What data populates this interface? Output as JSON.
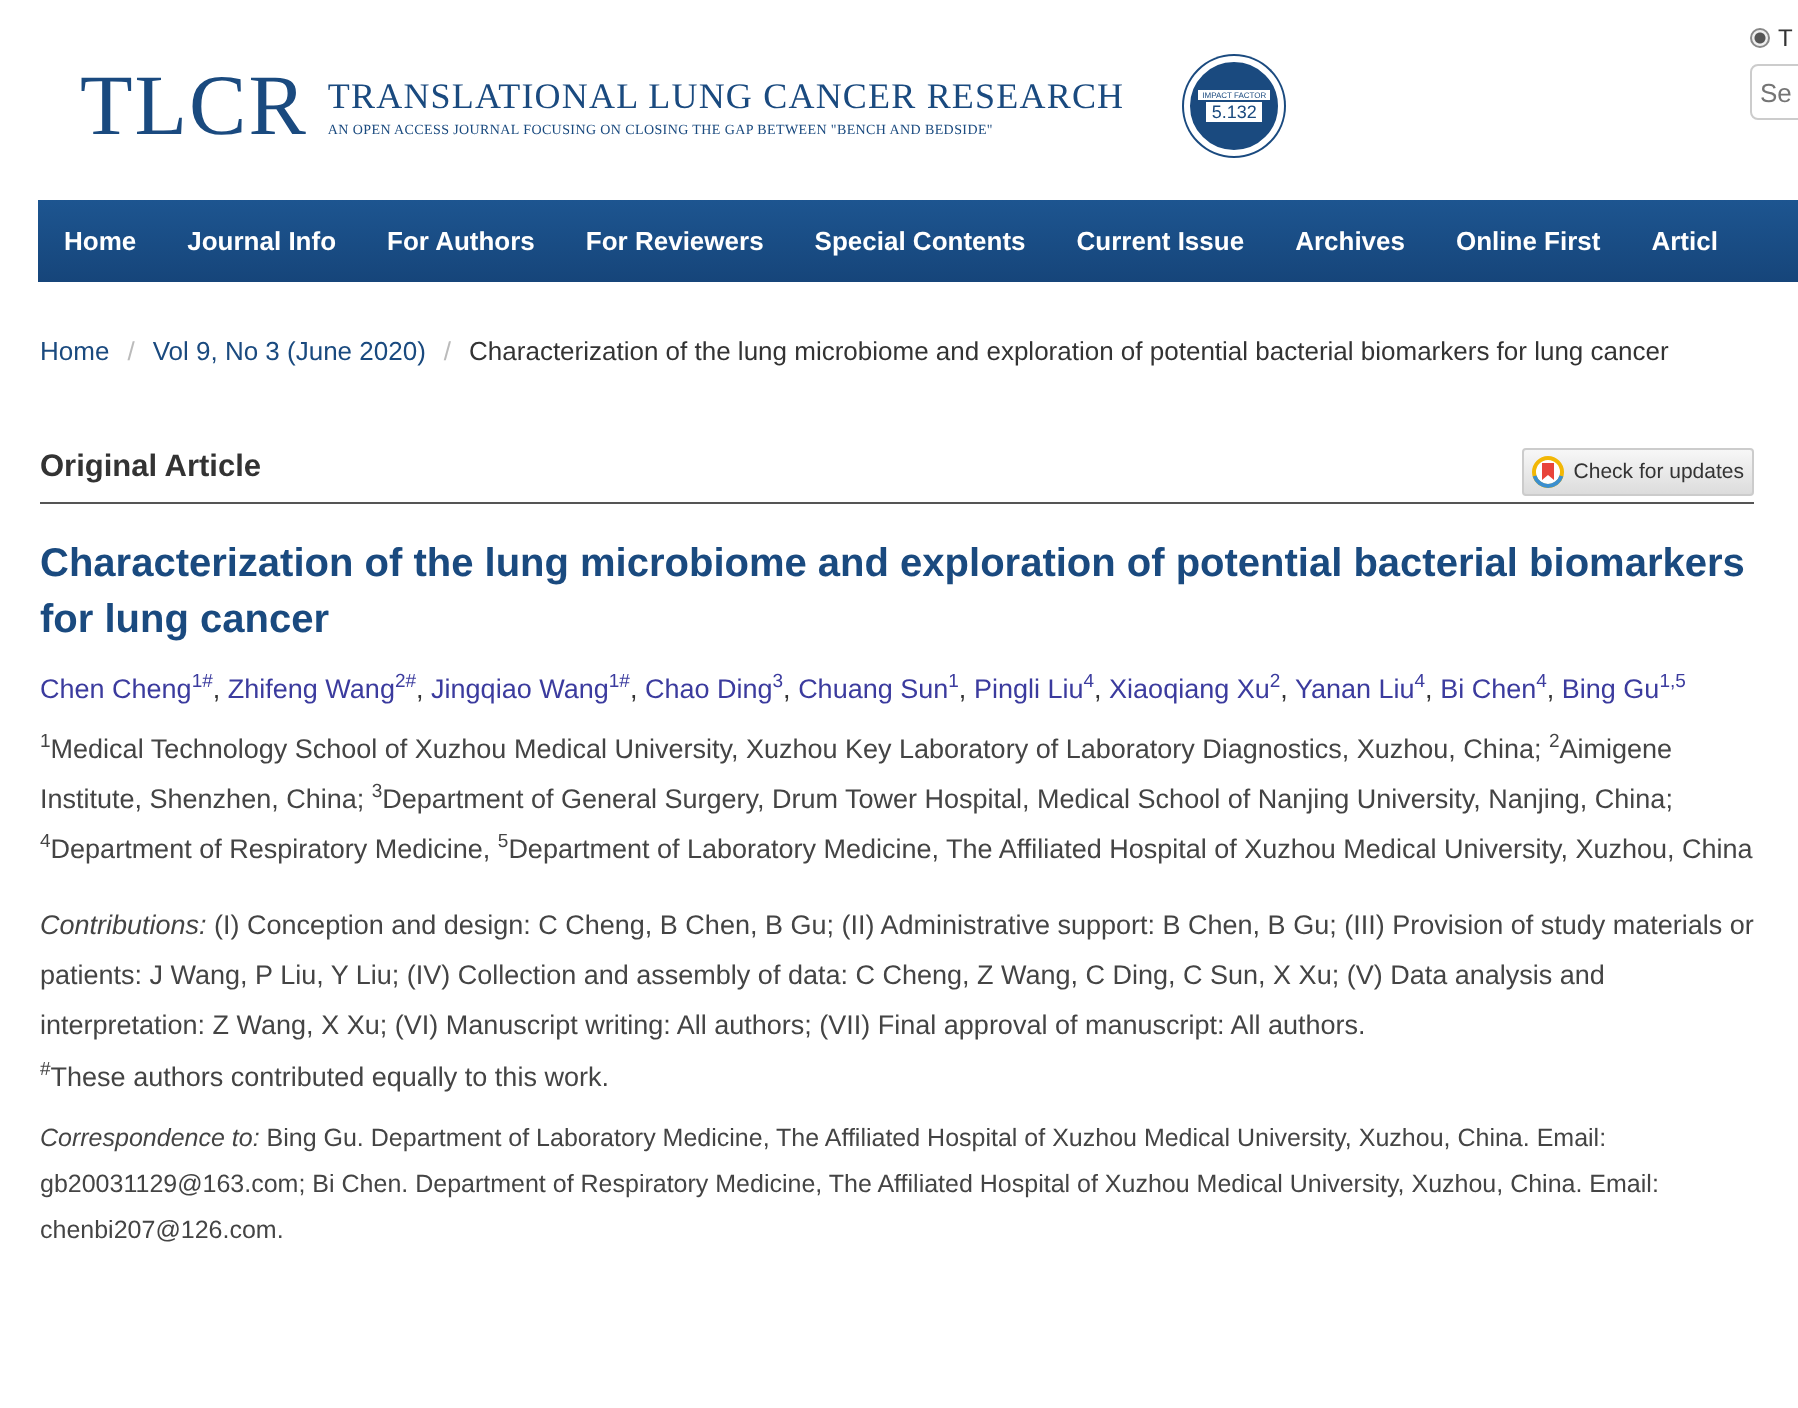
{
  "header": {
    "logo": "TLCR",
    "journal_name": "TRANSLATIONAL LUNG CANCER RESEARCH",
    "tagline": "AN OPEN ACCESS JOURNAL FOCUSING ON CLOSING THE GAP BETWEEN \"BENCH AND BEDSIDE\"",
    "badge": {
      "label": "IMPACT FACTOR",
      "value": "5.132"
    },
    "search_option": {
      "label": "T",
      "selected": true
    },
    "search": {
      "placeholder": "Se"
    }
  },
  "nav": [
    {
      "label": "Home"
    },
    {
      "label": "Journal Info"
    },
    {
      "label": "For Authors"
    },
    {
      "label": "For Reviewers"
    },
    {
      "label": "Special Contents"
    },
    {
      "label": "Current Issue"
    },
    {
      "label": "Archives"
    },
    {
      "label": "Online First"
    },
    {
      "label": "Articl"
    }
  ],
  "breadcrumb": [
    {
      "label": "Home",
      "kind": "link"
    },
    {
      "label": "Vol 9, No 3 (June 2020)",
      "kind": "link"
    },
    {
      "label": "Characterization of the lung microbiome and exploration of potential bacterial biomarkers for lung cancer",
      "kind": "current"
    }
  ],
  "breadcrumb_separator": "/",
  "section": "Original Article",
  "updates_button": "Check for updates",
  "title": "Characterization of the lung microbiome and exploration of potential bacterial biomarkers for lung cancer",
  "authors": [
    {
      "name": "Chen Cheng",
      "sup": "1#",
      "sep": ","
    },
    {
      "name": "Zhifeng Wang",
      "sup": "2#",
      "sep": ","
    },
    {
      "name": "Jingqiao Wang",
      "sup": "1#",
      "sep": ","
    },
    {
      "name": "Chao Ding",
      "sup": "3",
      "sep": ","
    },
    {
      "name": "Chuang Sun",
      "sup": "1",
      "sep": ","
    },
    {
      "name": "Pingli Liu",
      "sup": "4",
      "sep": ","
    },
    {
      "name": "Xiaoqiang Xu",
      "sup": "2",
      "sep": ","
    },
    {
      "name": "Yanan Liu",
      "sup": "4",
      "sep": ","
    },
    {
      "name": "Bi Chen",
      "sup": "4",
      "sep": ","
    },
    {
      "name": "Bing Gu",
      "sup": "1,5"
    }
  ],
  "affiliations": "$^{1}$Medical Technology School of Xuzhou Medical University, Xuzhou Key Laboratory of Laboratory Diagnostics, Xuzhou, China; $^{2}$Aimigene Institute, Shenzhen, China; $^{3}$Department of General Surgery, Drum Tower Hospital, Medical School of Nanjing University, Nanjing, China; $^{4}$Department of Respiratory Medicine, $^{5}$Department of Laboratory Medicine, The Affiliated Hospital of Xuzhou Medical University, Xuzhou, China",
  "contributions": "*Contributions:* (I) Conception and design: C Cheng, B Chen, B Gu; (II) Administrative support: B Chen, B Gu; (III) Provision of study materials or patients: J Wang, P Liu, Y Liu; (IV) Collection and assembly of data: C Cheng, Z Wang, C Ding, C Sun, X Xu; (V) Data analysis and interpretation: Z Wang, X Xu; (VI) Manuscript writing: All authors; (VII) Final approval of manuscript: All authors.",
  "equal_note": "$^{#}$These authors contributed equally to this work.",
  "correspondence": "*Correspondence to:* Bing Gu. Department of Laboratory Medicine, The Affiliated Hospital of Xuzhou Medical University, Xuzhou, China. Email: gb20031129@163.com; Bi Chen. Department of Respiratory Medicine, The Affiliated Hospital of Xuzhou Medical University, Xuzhou, China. Email: chenbi207@126.com."
}
